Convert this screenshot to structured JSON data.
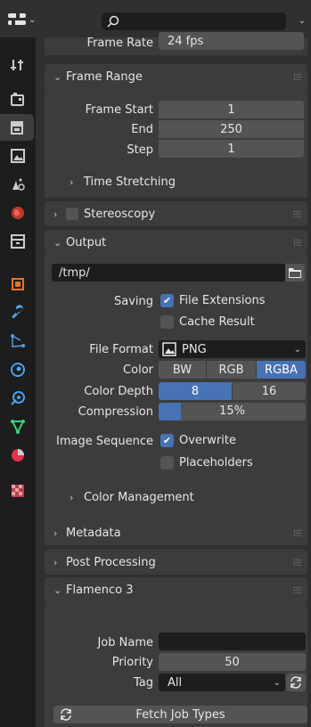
{
  "header": {
    "editor_icon": "properties-editor-icon",
    "search_placeholder": ""
  },
  "tabs": [
    {
      "icon": "tool-icon",
      "active": false
    },
    {
      "icon": "render-icon",
      "active": false
    },
    {
      "icon": "output-icon",
      "active": true
    },
    {
      "icon": "view-layer-icon",
      "active": false
    },
    {
      "icon": "scene-icon",
      "active": false
    },
    {
      "icon": "world-icon",
      "active": false
    },
    {
      "icon": "collection-icon",
      "active": false
    },
    {
      "icon": "object-icon",
      "active": false
    },
    {
      "icon": "modifier-wrench-icon",
      "active": false
    },
    {
      "icon": "particles-icon",
      "active": false
    },
    {
      "icon": "physics-icon",
      "active": false
    },
    {
      "icon": "constraints-icon",
      "active": false
    },
    {
      "icon": "data-icon",
      "active": false
    },
    {
      "icon": "material-icon",
      "active": false
    },
    {
      "icon": "texture-icon",
      "active": false
    }
  ],
  "format_panel": {
    "frame_rate_label": "Frame Rate",
    "frame_rate_value": "24 fps"
  },
  "frame_range": {
    "title": "Frame Range",
    "start_label": "Frame Start",
    "start_value": "1",
    "end_label": "End",
    "end_value": "250",
    "step_label": "Step",
    "step_value": "1",
    "time_stretching": "Time Stretching"
  },
  "stereoscopy": {
    "title": "Stereoscopy",
    "enabled": false
  },
  "output": {
    "title": "Output",
    "path": "/tmp/",
    "saving_label": "Saving",
    "file_extensions": "File Extensions",
    "file_extensions_checked": true,
    "cache_result": "Cache Result",
    "cache_result_checked": false,
    "file_format_label": "File Format",
    "file_format_value": "PNG",
    "color_label": "Color",
    "color_options": [
      "BW",
      "RGB",
      "RGBA"
    ],
    "color_selected": "RGBA",
    "color_depth_label": "Color Depth",
    "color_depth_options": [
      "8",
      "16"
    ],
    "color_depth_selected": "8",
    "compression_label": "Compression",
    "compression_value": "15%",
    "compression_fraction": 0.15,
    "image_sequence_label": "Image Sequence",
    "overwrite": "Overwrite",
    "overwrite_checked": true,
    "placeholders": "Placeholders",
    "placeholders_checked": false,
    "color_management": "Color Management"
  },
  "metadata": {
    "title": "Metadata"
  },
  "post_processing": {
    "title": "Post Processing"
  },
  "flamenco": {
    "title": "Flamenco 3",
    "job_name_label": "Job Name",
    "job_name_value": "",
    "priority_label": "Priority",
    "priority_value": "50",
    "tag_label": "Tag",
    "tag_value": "All",
    "fetch_button": "Fetch Job Types"
  },
  "colors": {
    "accent": "#4772b3",
    "panel": "#3c3c3c",
    "field": "#545454",
    "bg": "#303030"
  }
}
